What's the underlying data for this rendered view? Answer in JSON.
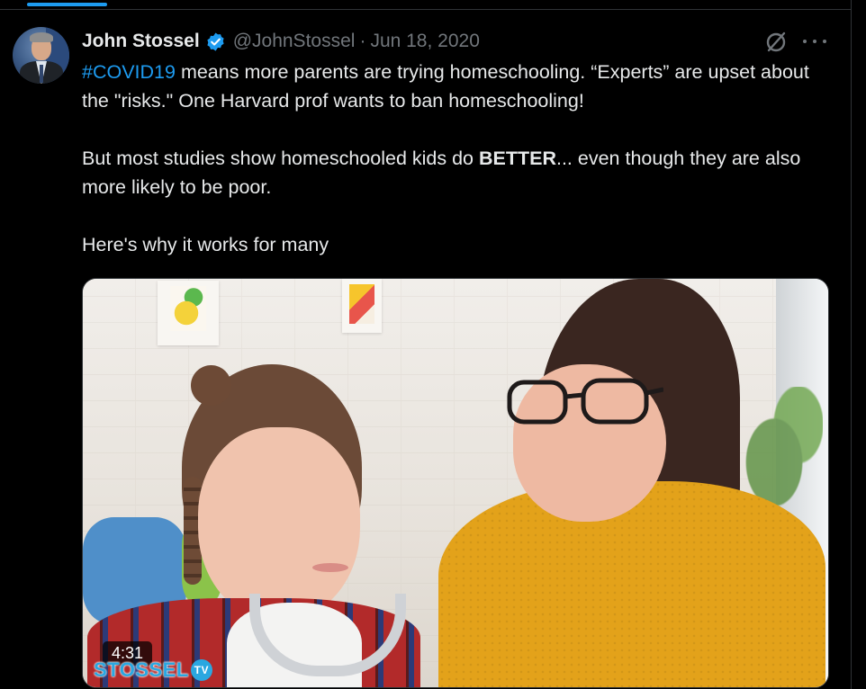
{
  "tweet": {
    "author_name": "John Stossel",
    "handle": "@JohnStossel",
    "separator": "·",
    "date": "Jun 18, 2020",
    "text": {
      "hashtag": "#COVID19",
      "p1_rest": " means more parents are trying homeschooling. “Experts” are upset about the \"risks.\" One Harvard prof wants to ban homeschooling!",
      "p2_pre": "But most studies show homeschooled kids do ",
      "p2_bold": "BETTER",
      "p2_post": "... even though they are also more likely to be poor.",
      "p3": "Here's why it works for many"
    },
    "media": {
      "duration": "4:31",
      "watermark": "STOSSEL",
      "watermark_badge": "TV"
    }
  },
  "icons": [
    "verified-badge-icon",
    "grok-icon",
    "more-options-icon"
  ],
  "colors": {
    "accent": "#1d9bf0",
    "text": "#e7e9ea",
    "muted": "#71767b",
    "background": "#000000",
    "border": "#2f3336"
  }
}
